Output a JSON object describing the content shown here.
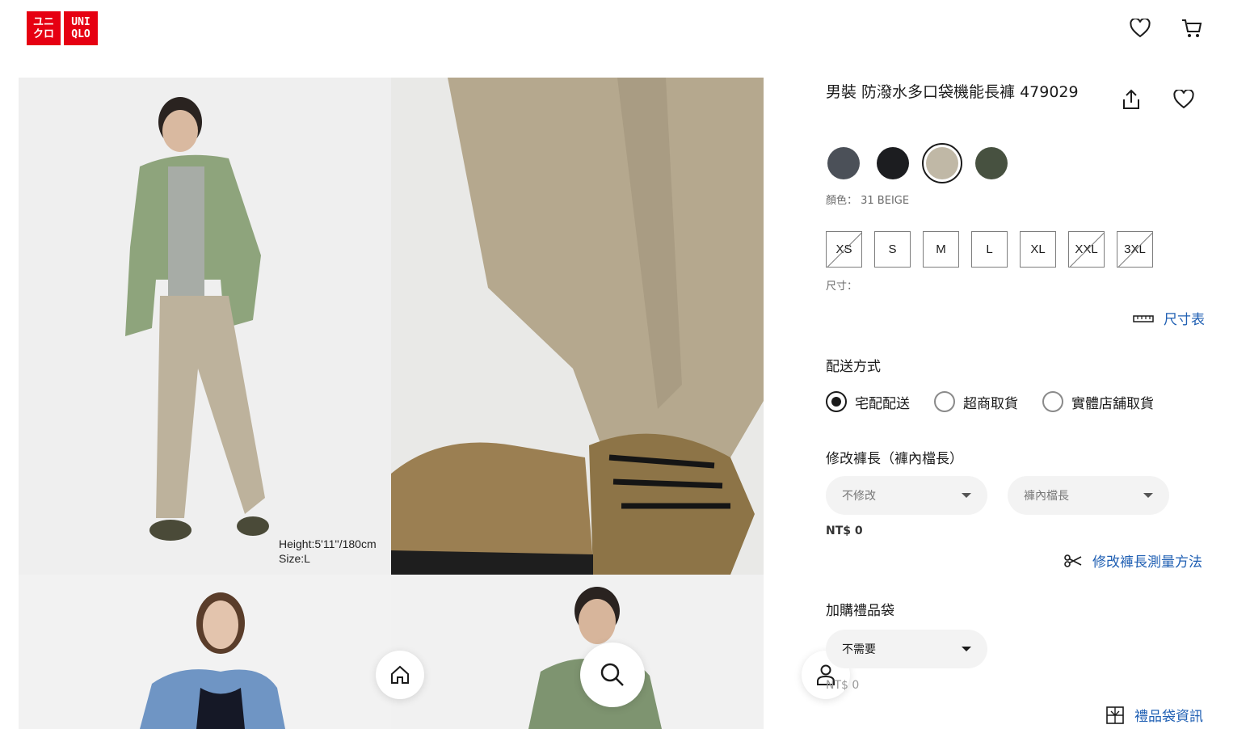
{
  "header": {
    "logo_left": "ユニ\nクロ",
    "logo_right": "UNI\nQLO",
    "icons": [
      "heart-icon",
      "cart-icon"
    ]
  },
  "gallery": {
    "caption_height": "Height:5'11''/180cm",
    "caption_size": "Size:L"
  },
  "product": {
    "title": "男裝 防潑水多口袋機能長褲 479029",
    "colors": [
      {
        "hex": "#4b5058",
        "selected": false
      },
      {
        "hex": "#1c1d20",
        "selected": false
      },
      {
        "hex": "#c0b8a6",
        "selected": true
      },
      {
        "hex": "#475140",
        "selected": false
      }
    ],
    "color_label": "顏色： 31 BEIGE",
    "sizes": [
      {
        "label": "XS",
        "available": false
      },
      {
        "label": "S",
        "available": true
      },
      {
        "label": "M",
        "available": true
      },
      {
        "label": "L",
        "available": true
      },
      {
        "label": "XL",
        "available": true
      },
      {
        "label": "XXL",
        "available": false
      },
      {
        "label": "3XL",
        "available": false
      }
    ],
    "size_label": "尺寸：",
    "size_chart_link": "尺寸表"
  },
  "delivery": {
    "heading": "配送方式",
    "options": [
      {
        "label": "宅配配送",
        "selected": true
      },
      {
        "label": "超商取貨",
        "selected": false
      },
      {
        "label": "實體店舖取貨",
        "selected": false
      }
    ]
  },
  "alteration": {
    "heading": "修改褲長（褲內檔長）",
    "select1": "不修改",
    "select2": "褲內檔長",
    "price": "NT$ 0",
    "link": "修改褲長測量方法"
  },
  "gift": {
    "heading": "加購禮品袋",
    "select": "不需要",
    "price": "NT$ 0",
    "link": "禮品袋資訊"
  },
  "bottom_nav": [
    "home-icon",
    "search-icon",
    "user-icon"
  ]
}
